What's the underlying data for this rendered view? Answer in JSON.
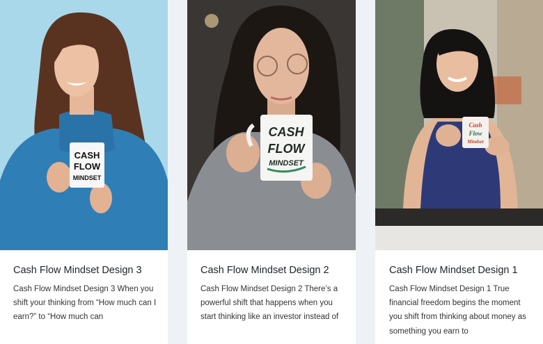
{
  "cards": [
    {
      "title": "Cash Flow Mindset Design 3",
      "excerpt": "Cash Flow Mindset Design 3 When you shift your thinking from “How much can I earn?” to “How much can",
      "mug_text": [
        "CASH",
        "FLOW",
        "MINDSET"
      ],
      "background_color": "#a9d8ea"
    },
    {
      "title": "Cash Flow Mindset Design 2",
      "excerpt": "Cash Flow Mindset Design 2 There’s a powerful shift that happens when you start thinking like an investor instead of",
      "mug_text": [
        "CASH",
        "FLOW",
        "MINDSET"
      ],
      "background_color": "#3a3634"
    },
    {
      "title": "Cash Flow Mindset Design 1",
      "excerpt": "Cash Flow Mindset Design 1 True financial freedom begins the moment you shift from thinking about money as something you earn to",
      "mug_text": [
        "Cash",
        "Flow",
        "Mindset"
      ],
      "background_color": "#c9c2b2"
    }
  ]
}
